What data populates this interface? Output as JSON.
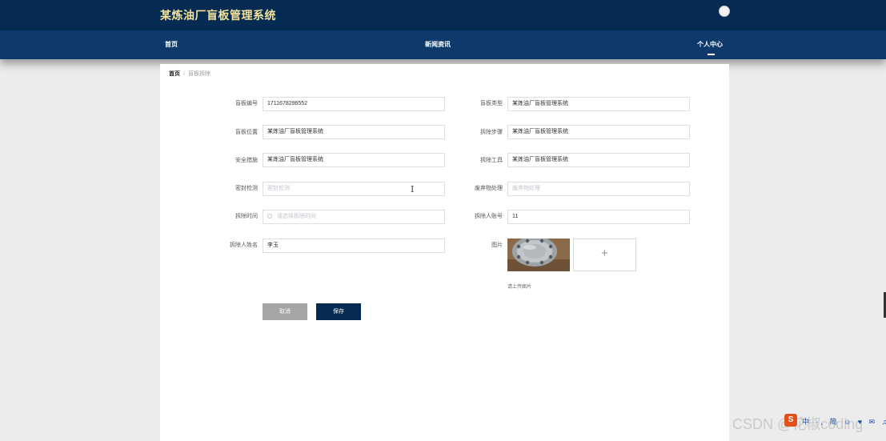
{
  "header": {
    "title": "某炼油厂盲板管理系统"
  },
  "nav": {
    "home": "首页",
    "news": "新闻资讯",
    "personal": "个人中心"
  },
  "breadcrumb": {
    "home": "首页",
    "separator": "/",
    "current": "盲板拆除"
  },
  "form": {
    "blind_no": {
      "label": "盲板编号",
      "value": "1711678296552"
    },
    "blind_type": {
      "label": "盲板类型",
      "value": "某炼油厂盲板管理系统"
    },
    "blind_location": {
      "label": "盲板位置",
      "value": "某炼油厂盲板管理系统"
    },
    "removal_steps": {
      "label": "拆除步骤",
      "value": "某炼油厂盲板管理系统"
    },
    "safety_measures": {
      "label": "安全措施",
      "value": "某炼油厂盲板管理系统"
    },
    "removal_tools": {
      "label": "拆除工具",
      "value": "某炼油厂盲板管理系统"
    },
    "seal_check": {
      "label": "密封检测",
      "placeholder": "密封检测"
    },
    "waste_disposal": {
      "label": "废弃物处理",
      "placeholder": "废弃物处理"
    },
    "removal_time": {
      "label": "拆除时间",
      "placeholder": "请选择拆除时间"
    },
    "remover_account": {
      "label": "拆除人账号",
      "value": "11"
    },
    "remover_name": {
      "label": "拆除人姓名",
      "value": "李玉"
    },
    "image": {
      "label": "图片",
      "upload_plus": "+",
      "hint": "请上传图片"
    }
  },
  "buttons": {
    "cancel": "取消",
    "save": "保存"
  },
  "watermark": {
    "text": "CSDN @花椒coding",
    "tray_logo": "S",
    "tray_icons": "中 ·, 简 ☺ ♥ ✉ ♫ ⚙"
  },
  "colors": {
    "header_bg": "#052b52",
    "nav_bg": "#0d3a6a",
    "title_color": "#f3e19c",
    "save_btn": "#052b52",
    "cancel_btn": "#a5a5a5"
  }
}
